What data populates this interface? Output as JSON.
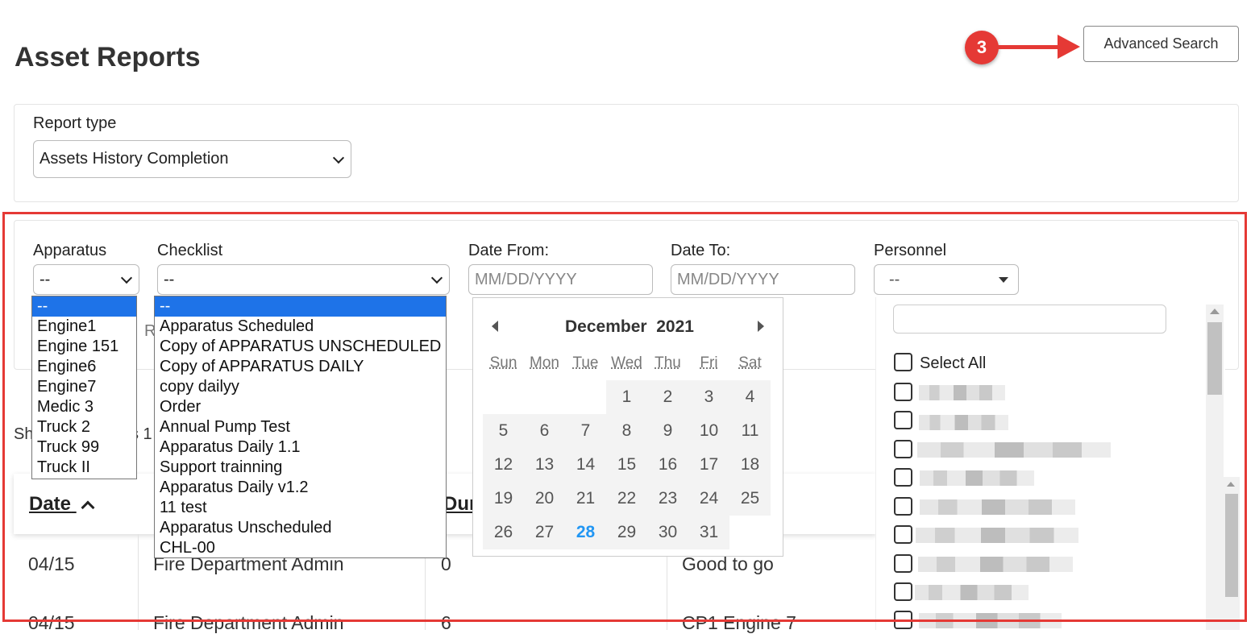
{
  "page": {
    "title": "Asset Reports"
  },
  "header": {
    "advanced_search_label": "Advanced Search",
    "step_badge": "3"
  },
  "report_type": {
    "label": "Report type",
    "value": "Assets History Completion"
  },
  "filters": {
    "apparatus": {
      "label": "Apparatus",
      "value": "--",
      "options": [
        "--",
        "Engine1",
        "Engine 151",
        "Engine6",
        "Engine7",
        "Medic 3",
        "Truck 2",
        "Truck 99",
        "Truck II"
      ]
    },
    "checklist": {
      "label": "Checklist",
      "value": "--",
      "options": [
        "--",
        "Apparatus Scheduled",
        "Copy of APPARATUS UNSCHEDULED",
        "Copy of APPARATUS DAILY",
        "copy dailyy",
        "Order",
        "Annual Pump Test",
        "Apparatus Daily 1.1",
        "Support trainning",
        "Apparatus Daily v1.2",
        "11 test",
        "Apparatus Unscheduled",
        "CHL-00"
      ]
    },
    "date_from": {
      "label": "Date From:",
      "placeholder": "MM/DD/YYYY"
    },
    "date_to": {
      "label": "Date To:",
      "placeholder": "MM/DD/YYYY"
    },
    "personnel": {
      "label": "Personnel",
      "value": "--",
      "select_all_label": "Select All"
    }
  },
  "calendar": {
    "month": "December",
    "year": "2021",
    "weekdays": [
      "Sun",
      "Mon",
      "Tue",
      "Wed",
      "Thu",
      "Fri",
      "Sat"
    ],
    "weeks": [
      [
        "",
        "",
        "",
        "1",
        "2",
        "3",
        "4"
      ],
      [
        "5",
        "6",
        "7",
        "8",
        "9",
        "10",
        "11"
      ],
      [
        "12",
        "13",
        "14",
        "15",
        "16",
        "17",
        "18"
      ],
      [
        "19",
        "20",
        "21",
        "22",
        "23",
        "24",
        "25"
      ],
      [
        "26",
        "27",
        "28",
        "29",
        "30",
        "31",
        ""
      ]
    ],
    "today": "28"
  },
  "partial": {
    "showing": "Sh",
    "showing2": "s 1",
    "r_text": "R"
  },
  "table": {
    "headers": {
      "date": "Date",
      "dur": "Dur"
    },
    "rows": [
      {
        "date": "04/15",
        "user": "Fire Department Admin",
        "dur": "0",
        "status": "Good to go"
      },
      {
        "date": "04/15",
        "user": "Fire Department Admin",
        "dur": "6",
        "status": "CP1 Engine 7"
      }
    ]
  }
}
